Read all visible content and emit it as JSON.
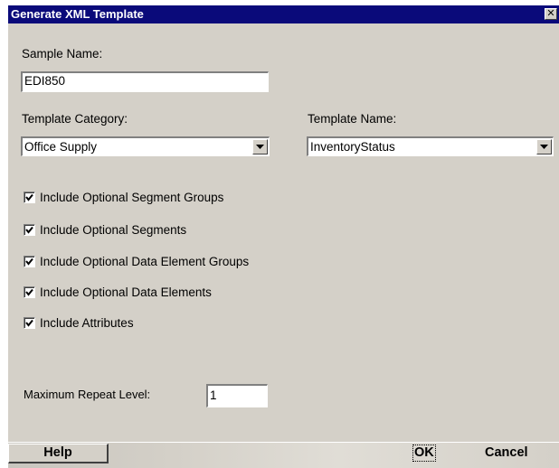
{
  "window": {
    "title": "Generate XML Template",
    "close_glyph": "✕"
  },
  "sample_name": {
    "label": "Sample Name:",
    "value": "EDI850"
  },
  "template_category": {
    "label": "Template Category:",
    "selected": "Office Supply"
  },
  "template_name": {
    "label": "Template Name:",
    "selected": "InventoryStatus"
  },
  "options": [
    {
      "label": "Include Optional Segment Groups",
      "checked": true
    },
    {
      "label": "Include Optional Segments",
      "checked": true
    },
    {
      "label": "Include Optional Data Element Groups",
      "checked": true
    },
    {
      "label": "Include Optional Data Elements",
      "checked": true
    },
    {
      "label": "Include Attributes",
      "checked": true
    }
  ],
  "max_repeat": {
    "label": "Maximum Repeat Level:",
    "value": "1"
  },
  "buttons": {
    "help": "Help",
    "ok": "OK",
    "cancel": "Cancel"
  },
  "colors": {
    "titlebar": "#0a0a7a",
    "panel": "#d4d0c8"
  },
  "icons": {
    "close": "close-icon",
    "dropdown": "chevron-down-icon",
    "check": "checkmark-icon"
  }
}
